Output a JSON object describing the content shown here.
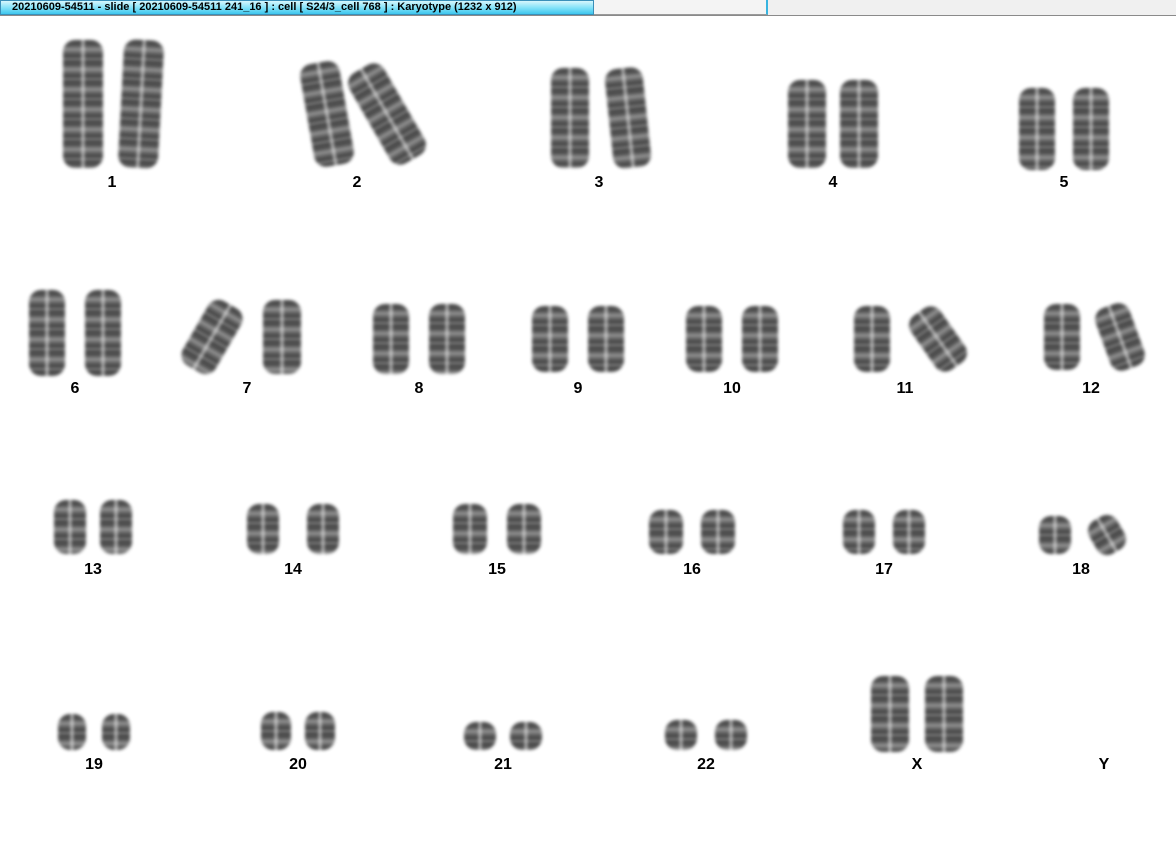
{
  "window": {
    "active_tab_title": "20210609-54511 - slide [ 20210609-54511 241_16 ] : cell [ S24/3_cell 768 ] : Karyotype  (1232 x 912)"
  },
  "karyotype": {
    "labels": [
      "1",
      "2",
      "3",
      "4",
      "5",
      "6",
      "7",
      "8",
      "9",
      "10",
      "11",
      "12",
      "13",
      "14",
      "15",
      "16",
      "17",
      "18",
      "19",
      "20",
      "21",
      "22",
      "X",
      "Y"
    ]
  }
}
